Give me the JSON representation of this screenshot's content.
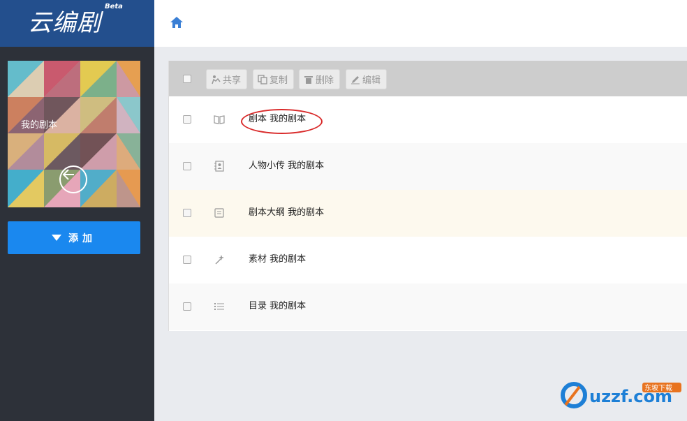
{
  "app": {
    "logo_text": "云编剧",
    "beta": "Beta"
  },
  "sidebar": {
    "cover_title": "我的剧本",
    "add_label": "添加"
  },
  "toolbar": {
    "share": "共享",
    "copy": "复制",
    "delete": "删除",
    "edit": "编辑"
  },
  "items": [
    {
      "label": "剧本 我的剧本",
      "icon": "book-open-icon"
    },
    {
      "label": "人物小传 我的剧本",
      "icon": "contact-book-icon"
    },
    {
      "label": "剧本大纲 我的剧本",
      "icon": "outline-doc-icon"
    },
    {
      "label": "素材 我的剧本",
      "icon": "magic-wand-icon"
    },
    {
      "label": "目录 我的剧本",
      "icon": "list-icon"
    }
  ],
  "watermark": {
    "text": "uzzf.com",
    "sub": "东坡下载"
  },
  "colors": {
    "sidebar_bg": "#2d3139",
    "logo_bg": "#234f8d",
    "accent": "#1a88ef",
    "toolbar_bg": "#cdcdcd",
    "highlight_row": "#fdf9ee",
    "annotation": "#d92b2b"
  }
}
